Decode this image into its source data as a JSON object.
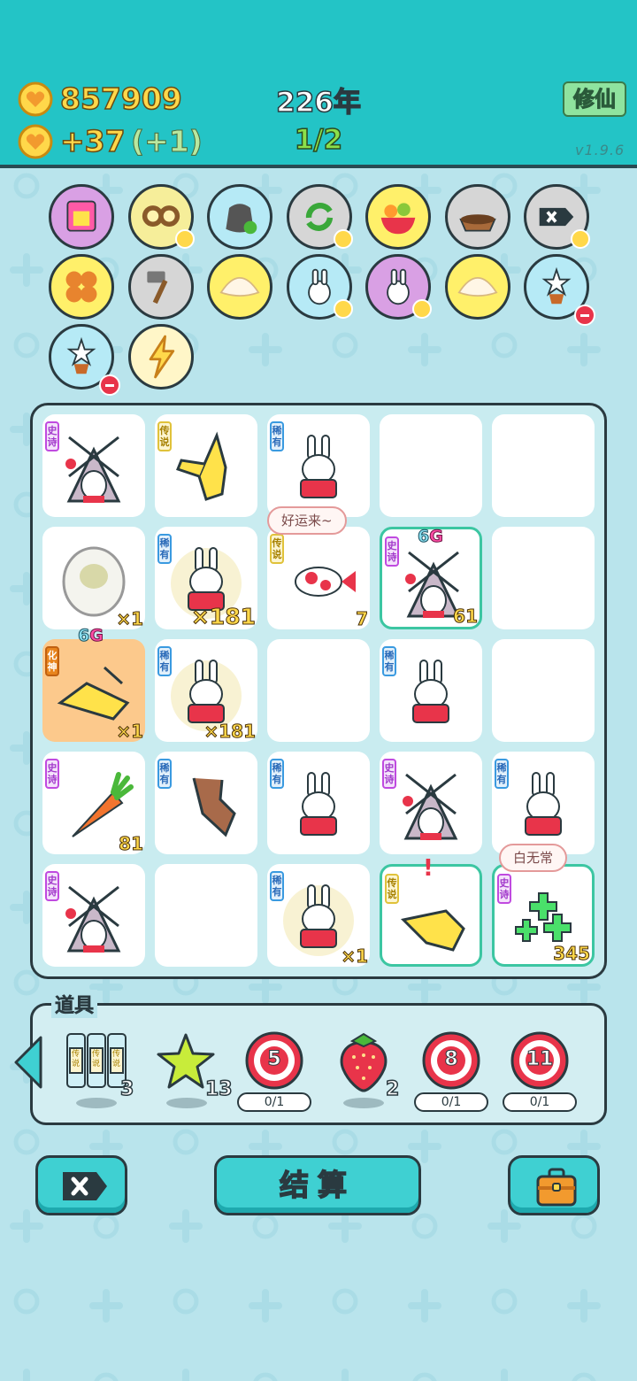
{
  "header": {
    "coins": "857909",
    "income": "+37",
    "income_bonus": "(+1)",
    "year": "226年",
    "progress": "1/2",
    "xiuxian_button": "修仙",
    "version": "v1.9.6"
  },
  "relics": [
    {
      "name": "pink-gift-relic",
      "bg": "#d9a0e4"
    },
    {
      "name": "owl-mask-relic",
      "bg": "#f6ee9a"
    },
    {
      "name": "trash-bag-relic",
      "bg": "#b6eaf6"
    },
    {
      "name": "recycle-relic",
      "bg": "#d6d6d6"
    },
    {
      "name": "fruit-bowl-relic",
      "bg": "#fff06a"
    },
    {
      "name": "pet-bowl-relic",
      "bg": "#d6d6d6"
    },
    {
      "name": "remove-tag-relic",
      "bg": "#d6d6d6"
    },
    {
      "name": "basketball-relic",
      "bg": "#fff06a"
    },
    {
      "name": "hammer-relic",
      "bg": "#d6d6d6"
    },
    {
      "name": "shell-relic",
      "bg": "#fff06a"
    },
    {
      "name": "bunny-relic",
      "bg": "#b6eaf6"
    },
    {
      "name": "bunny-relic-purple",
      "bg": "#d9a0e4"
    },
    {
      "name": "shell-relic-2",
      "bg": "#fff06a"
    },
    {
      "name": "flower-pot-relic",
      "bg": "#b6eaf6"
    },
    {
      "name": "flower-pot-relic-2",
      "bg": "#b6eaf6"
    },
    {
      "name": "lightning-relic",
      "bg": "#fff6c8"
    }
  ],
  "grid": {
    "cells": [
      {
        "art": "tent",
        "tag": "史诗",
        "tagClass": "epic"
      },
      {
        "art": "hand",
        "tag": "传说",
        "tagClass": "leg"
      },
      {
        "art": "bunny",
        "tag": "稀有",
        "tagClass": "rare"
      },
      {
        "art": "",
        "tag": ""
      },
      {
        "art": "",
        "tag": ""
      },
      {
        "art": "sheep",
        "tag": "",
        "count": "×1"
      },
      {
        "art": "bunny-glow",
        "tag": "稀有",
        "tagClass": "rare",
        "count": "×181",
        "big": true
      },
      {
        "art": "fish",
        "tag": "传说",
        "tagClass": "leg",
        "count": "7"
      },
      {
        "art": "tent",
        "tag": "史诗",
        "tagClass": "epic",
        "count": "61",
        "hl": true
      },
      {
        "art": "",
        "tag": ""
      },
      {
        "art": "hand-big",
        "tag": "化神",
        "tagClass": "hua",
        "count": "×1",
        "orange": true
      },
      {
        "art": "bunny-glow",
        "tag": "稀有",
        "tagClass": "rare",
        "count": "×181"
      },
      {
        "art": "",
        "tag": ""
      },
      {
        "art": "bunny",
        "tag": "稀有",
        "tagClass": "rare"
      },
      {
        "art": "",
        "tag": ""
      },
      {
        "art": "carrot",
        "tag": "史诗",
        "tagClass": "epic",
        "count": "81"
      },
      {
        "art": "rock-hand",
        "tag": "稀有",
        "tagClass": "rare"
      },
      {
        "art": "bunny",
        "tag": "稀有",
        "tagClass": "rare"
      },
      {
        "art": "tent",
        "tag": "史诗",
        "tagClass": "epic"
      },
      {
        "art": "bunny",
        "tag": "稀有",
        "tagClass": "rare"
      },
      {
        "art": "tent",
        "tag": "史诗",
        "tagClass": "epic"
      },
      {
        "art": "",
        "tag": ""
      },
      {
        "art": "bunny-glow",
        "tag": "稀有",
        "tagClass": "rare",
        "count": "×1"
      },
      {
        "art": "hand-point",
        "tag": "传说",
        "tagClass": "leg",
        "hl": true
      },
      {
        "art": "clover",
        "tag": "史诗",
        "tagClass": "epic",
        "count": "345",
        "hl": true
      }
    ],
    "badge_6g_a": "6",
    "badge_6g_b": "6",
    "bubble_luck": "好运来~",
    "bubble_wuchang": "白无常",
    "exclaim": "!"
  },
  "items": {
    "title": "道具",
    "scroll_count": "3",
    "scroll_label": "传说",
    "star_count": "13",
    "target1": "5",
    "target1_progress": "0/1",
    "strawberry_count": "2",
    "target2": "8",
    "target2_progress": "0/1",
    "target3": "11",
    "target3_progress": "0/1"
  },
  "buttons": {
    "settle": "结算"
  },
  "colors": {
    "header": "#23c4c6",
    "background": "#b9e4ec",
    "coin": "#ffd84a",
    "accent_button": "#3fd0d2"
  }
}
